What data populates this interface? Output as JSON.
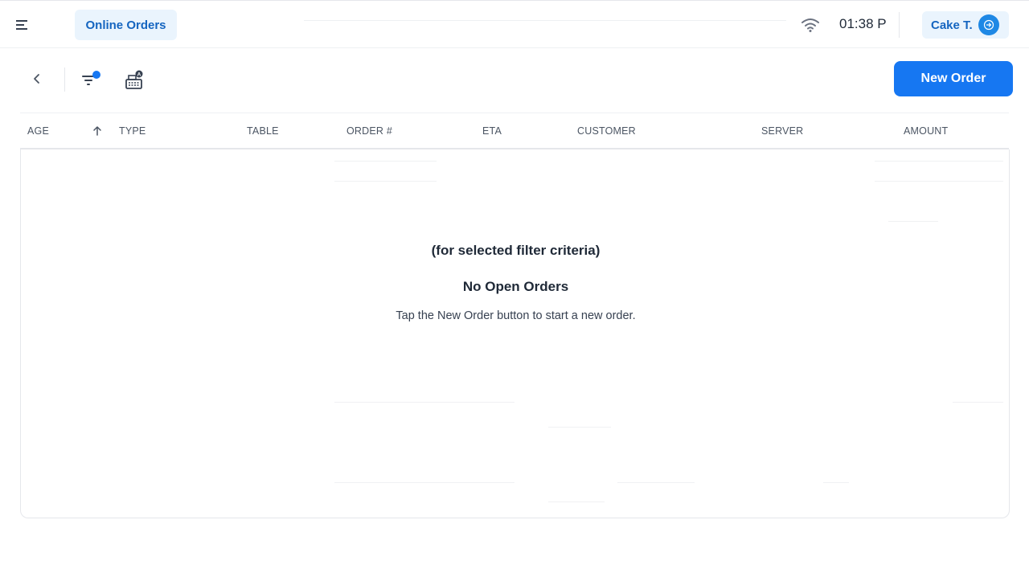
{
  "topbar": {
    "menu_icon": "menu-icon",
    "active_tab_label": "Online Orders",
    "wifi_icon": "wifi-icon",
    "time": "01:38 P",
    "user_name": "Cake T.",
    "logout_icon": "logout-icon"
  },
  "toolbar": {
    "back_icon": "chevron-left-icon",
    "filter_icon": "filter-icon",
    "register_icon": "cash-register-icon",
    "new_order_label": "New Order"
  },
  "table": {
    "columns": [
      "AGE",
      "TYPE",
      "TABLE",
      "ORDER #",
      "ETA",
      "CUSTOMER",
      "SERVER",
      "AMOUNT"
    ],
    "sort_icon": "arrow-up-icon"
  },
  "empty_state": {
    "subtitle": "(for selected filter criteria)",
    "title": "No Open Orders",
    "hint": "Tap the New Order button to start a new order."
  },
  "colors": {
    "accent": "#1677f2",
    "tab_bg": "#eaf4fd",
    "tab_text": "#1565c0",
    "badge": "#1e88e5"
  }
}
